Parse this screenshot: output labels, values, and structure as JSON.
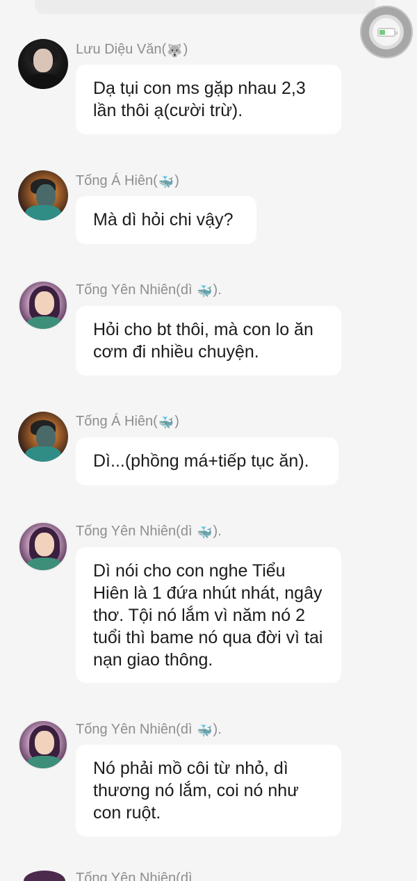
{
  "messages": [
    {
      "sender": "Lưu Diệu Văn",
      "sender_icon": "🐺",
      "name_suffix": "",
      "avatar": "male",
      "text": "Dạ tụi con ms gặp nhau 2,3 lần thôi ạ(cười trừ)."
    },
    {
      "sender": "Tống Á Hiên",
      "sender_icon": "🐳",
      "name_suffix": "",
      "avatar": "hien",
      "text": "Mà dì hỏi chi vậy?"
    },
    {
      "sender": "Tống Yên Nhiên(dì",
      "sender_icon": "🐳",
      "name_suffix": ".",
      "avatar": "nhien",
      "text": "Hỏi cho bt thôi, mà con lo ăn cơm đi nhiều chuyện."
    },
    {
      "sender": "Tống Á Hiên",
      "sender_icon": "🐳",
      "name_suffix": "",
      "avatar": "hien",
      "text": "Dì...(phồng má+tiếp tục ăn)."
    },
    {
      "sender": "Tống Yên Nhiên(dì",
      "sender_icon": "🐳",
      "name_suffix": ".",
      "avatar": "nhien",
      "text": "Dì nói cho con nghe Tiểu Hiên là 1 đứa nhút nhát, ngây thơ. Tội nó lắm vì năm nó 2 tuổi thì bame  nó qua đời vì tai nạn giao thông."
    },
    {
      "sender": "Tống Yên Nhiên(dì",
      "sender_icon": "🐳",
      "name_suffix": ".",
      "avatar": "nhien",
      "text": "Nó phải mồ côi từ nhỏ, dì thương nó lắm, coi nó như con ruột."
    }
  ],
  "peek": {
    "sender": "Tống Yên Nhiên(dì"
  },
  "floating_button": {
    "icon": "battery-icon"
  }
}
